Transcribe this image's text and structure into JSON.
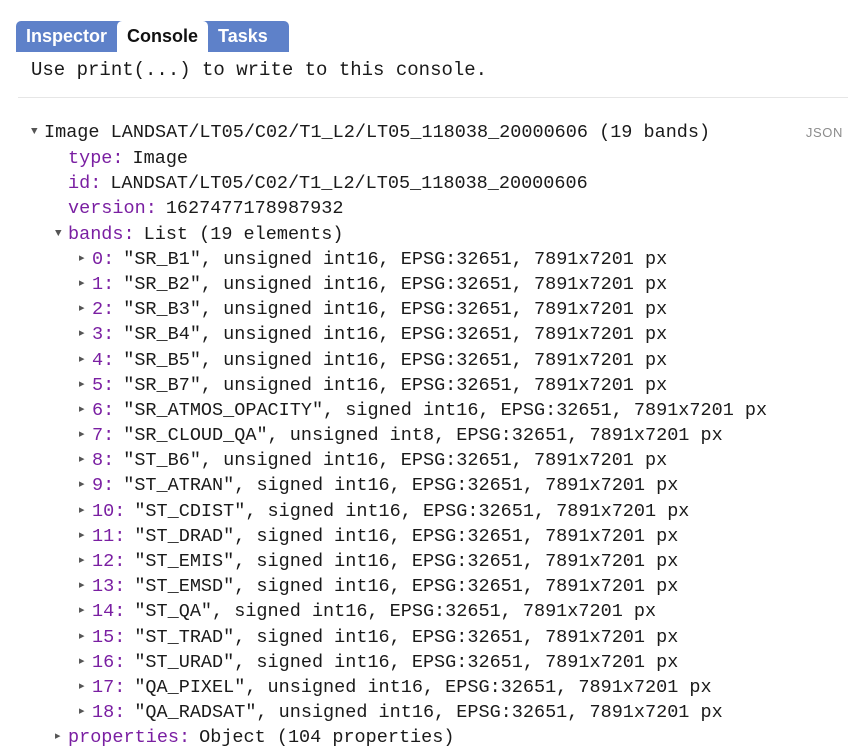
{
  "tabs": [
    {
      "label": "Inspector",
      "active": false
    },
    {
      "label": "Console",
      "active": true
    },
    {
      "label": "Tasks",
      "active": false
    }
  ],
  "console": {
    "hint": "Use print(...) to write to this console.",
    "json_label": "JSON"
  },
  "tree": {
    "header": {
      "arrow": "▼",
      "text": "Image LANDSAT/LT05/C02/T1_L2/LT05_118038_20000606 (19 bands)"
    },
    "type_key": "type:",
    "type_value": "Image",
    "id_key": "id:",
    "id_value": "LANDSAT/LT05/C02/T1_L2/LT05_118038_20000606",
    "version_key": "version:",
    "version_value": "1627477178987932",
    "bands_key": "bands:",
    "bands_value": "List (19 elements)",
    "properties_key": "properties:",
    "properties_value": "Object (104 properties)",
    "collapsed_arrow": "▸",
    "expanded_arrow": "▼",
    "bands": [
      {
        "index": "0:",
        "text": "\"SR_B1\", unsigned int16, EPSG:32651, 7891x7201 px"
      },
      {
        "index": "1:",
        "text": "\"SR_B2\", unsigned int16, EPSG:32651, 7891x7201 px"
      },
      {
        "index": "2:",
        "text": "\"SR_B3\", unsigned int16, EPSG:32651, 7891x7201 px"
      },
      {
        "index": "3:",
        "text": "\"SR_B4\", unsigned int16, EPSG:32651, 7891x7201 px"
      },
      {
        "index": "4:",
        "text": "\"SR_B5\", unsigned int16, EPSG:32651, 7891x7201 px"
      },
      {
        "index": "5:",
        "text": "\"SR_B7\", unsigned int16, EPSG:32651, 7891x7201 px"
      },
      {
        "index": "6:",
        "text": "\"SR_ATMOS_OPACITY\", signed int16, EPSG:32651, 7891x7201 px"
      },
      {
        "index": "7:",
        "text": "\"SR_CLOUD_QA\", unsigned int8, EPSG:32651, 7891x7201 px"
      },
      {
        "index": "8:",
        "text": "\"ST_B6\", unsigned int16, EPSG:32651, 7891x7201 px"
      },
      {
        "index": "9:",
        "text": "\"ST_ATRAN\", signed int16, EPSG:32651, 7891x7201 px"
      },
      {
        "index": "10:",
        "text": "\"ST_CDIST\", signed int16, EPSG:32651, 7891x7201 px"
      },
      {
        "index": "11:",
        "text": "\"ST_DRAD\", signed int16, EPSG:32651, 7891x7201 px"
      },
      {
        "index": "12:",
        "text": "\"ST_EMIS\", signed int16, EPSG:32651, 7891x7201 px"
      },
      {
        "index": "13:",
        "text": "\"ST_EMSD\", signed int16, EPSG:32651, 7891x7201 px"
      },
      {
        "index": "14:",
        "text": "\"ST_QA\", signed int16, EPSG:32651, 7891x7201 px"
      },
      {
        "index": "15:",
        "text": "\"ST_TRAD\", signed int16, EPSG:32651, 7891x7201 px"
      },
      {
        "index": "16:",
        "text": "\"ST_URAD\", signed int16, EPSG:32651, 7891x7201 px"
      },
      {
        "index": "17:",
        "text": "\"QA_PIXEL\", unsigned int16, EPSG:32651, 7891x7201 px"
      },
      {
        "index": "18:",
        "text": "\"QA_RADSAT\", unsigned int16, EPSG:32651, 7891x7201 px"
      }
    ]
  },
  "colors": {
    "tab_bar_blue": "#5e81c9",
    "key_purple": "#7a1fa2",
    "text": "#1a1a1a",
    "json_gray": "#8c8c8c"
  }
}
